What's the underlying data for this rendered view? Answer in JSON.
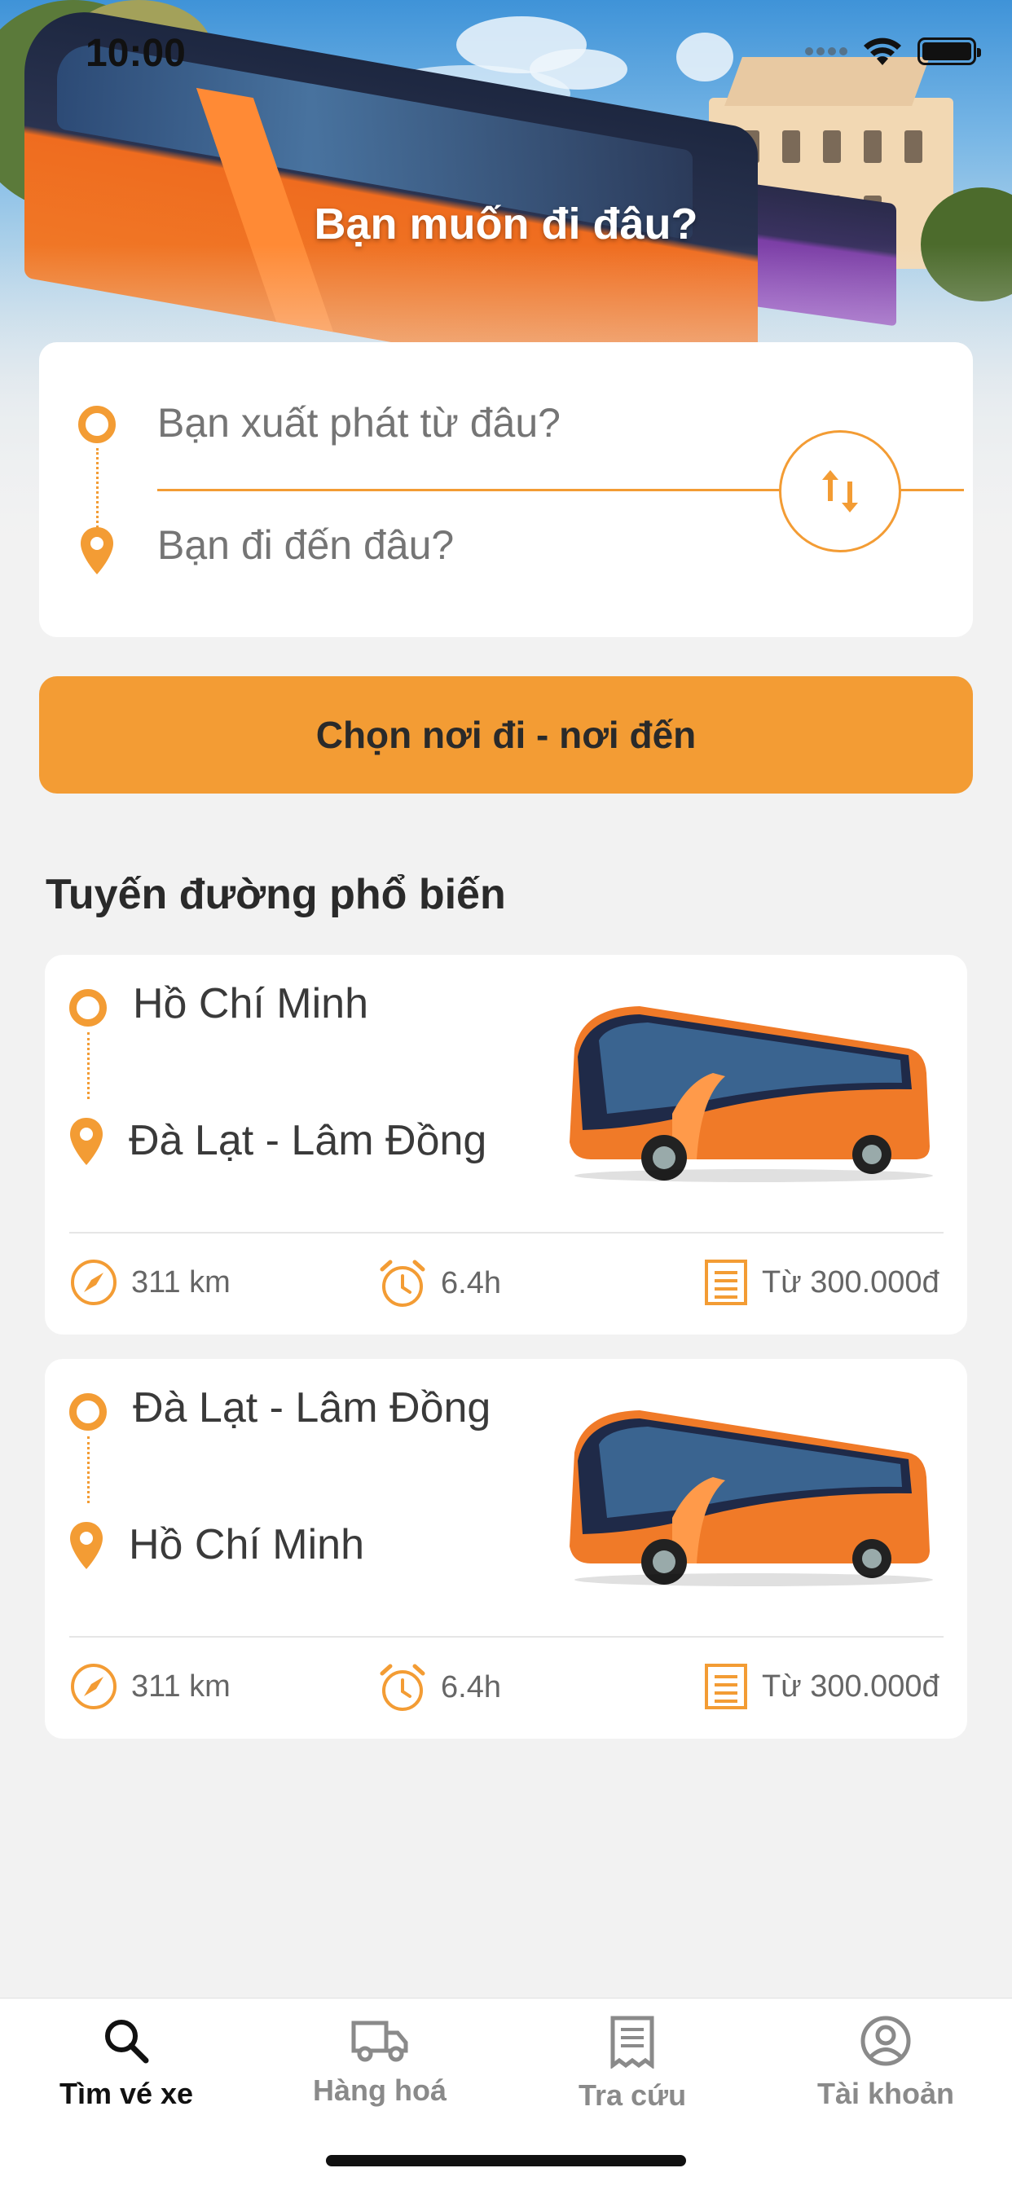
{
  "status_bar": {
    "time": "10:00"
  },
  "hero": {
    "title": "Bạn muốn đi đâu?"
  },
  "search": {
    "from_placeholder": "Bạn xuất phát từ đâu?",
    "to_placeholder": "Bạn đi đến đâu?",
    "swap_icon": "swap-arrows-icon"
  },
  "cta_label": "Chọn nơi đi - nơi đến",
  "popular": {
    "title": "Tuyến đường phổ biến",
    "routes": [
      {
        "from": "Hồ Chí Minh",
        "to": "Đà Lạt - Lâm Đồng",
        "distance": "311 km",
        "duration": "6.4h",
        "price": "Từ  300.000đ"
      },
      {
        "from": "Đà Lạt - Lâm Đồng",
        "to": "Hồ Chí Minh",
        "distance": "311 km",
        "duration": "6.4h",
        "price": "Từ  300.000đ"
      }
    ]
  },
  "tabs": [
    {
      "label": "Tìm vé xe",
      "icon": "search-icon",
      "active": true
    },
    {
      "label": "Hàng hoá",
      "icon": "truck-icon",
      "active": false
    },
    {
      "label": "Tra cứu",
      "icon": "receipt-icon",
      "active": false
    },
    {
      "label": "Tài khoản",
      "icon": "account-icon",
      "active": false
    }
  ],
  "colors": {
    "accent": "#f39c34",
    "background": "#f2f2f2",
    "card": "#ffffff",
    "text": "#2a2a2a"
  }
}
